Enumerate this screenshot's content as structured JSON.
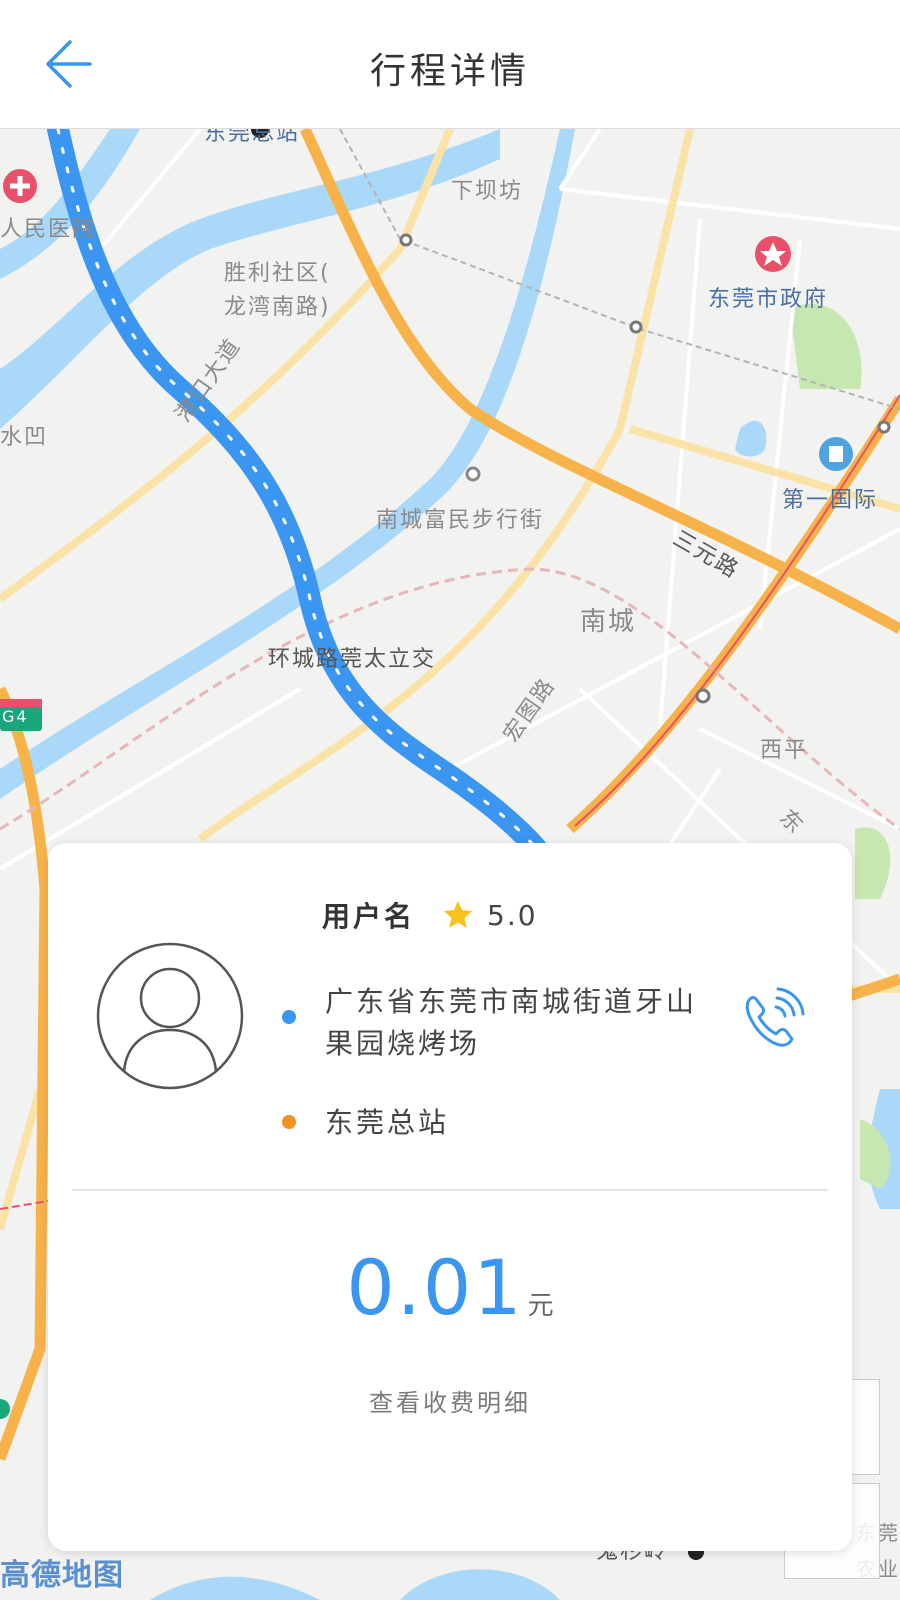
{
  "header": {
    "title": "行程详情",
    "back_icon": "arrow-left-icon"
  },
  "map": {
    "labels": {
      "hospital": "人民医院",
      "xiabafang": "下坝坊",
      "shengli": "胜利社区(",
      "longwan": "龙湾南路)",
      "gov": "东莞市政府",
      "shuiao": "水凹",
      "gangkou": "港口大道",
      "street": "南城富民步行街",
      "guoji": "第一国际",
      "sanyuan": "三元路",
      "nancheng": "南城",
      "interchange": "环城路莞太立交",
      "hongtu": "宏图路",
      "xiping": "西平",
      "g4": "G4",
      "guishanling": "鬼杉岭",
      "station_top": "东莞总站",
      "dong": "东",
      "dongguan_right": "东莞",
      "nongye": "农业"
    },
    "brand": "高德地图",
    "colors": {
      "route": "#3a96f0",
      "water": "#a9d8f8",
      "major_road": "#f7b24a",
      "minor_road": "#fbe3a8"
    }
  },
  "card": {
    "user_name": "用户名",
    "star_icon": "star-icon",
    "rating": "5.0",
    "start_address": "广东省东莞市南城街道牙山果园烧烤场",
    "end_address": "东莞总站",
    "phone_icon": "phone-icon",
    "price": "0.01",
    "price_unit": "元",
    "fee_detail": "查看收费明细"
  }
}
